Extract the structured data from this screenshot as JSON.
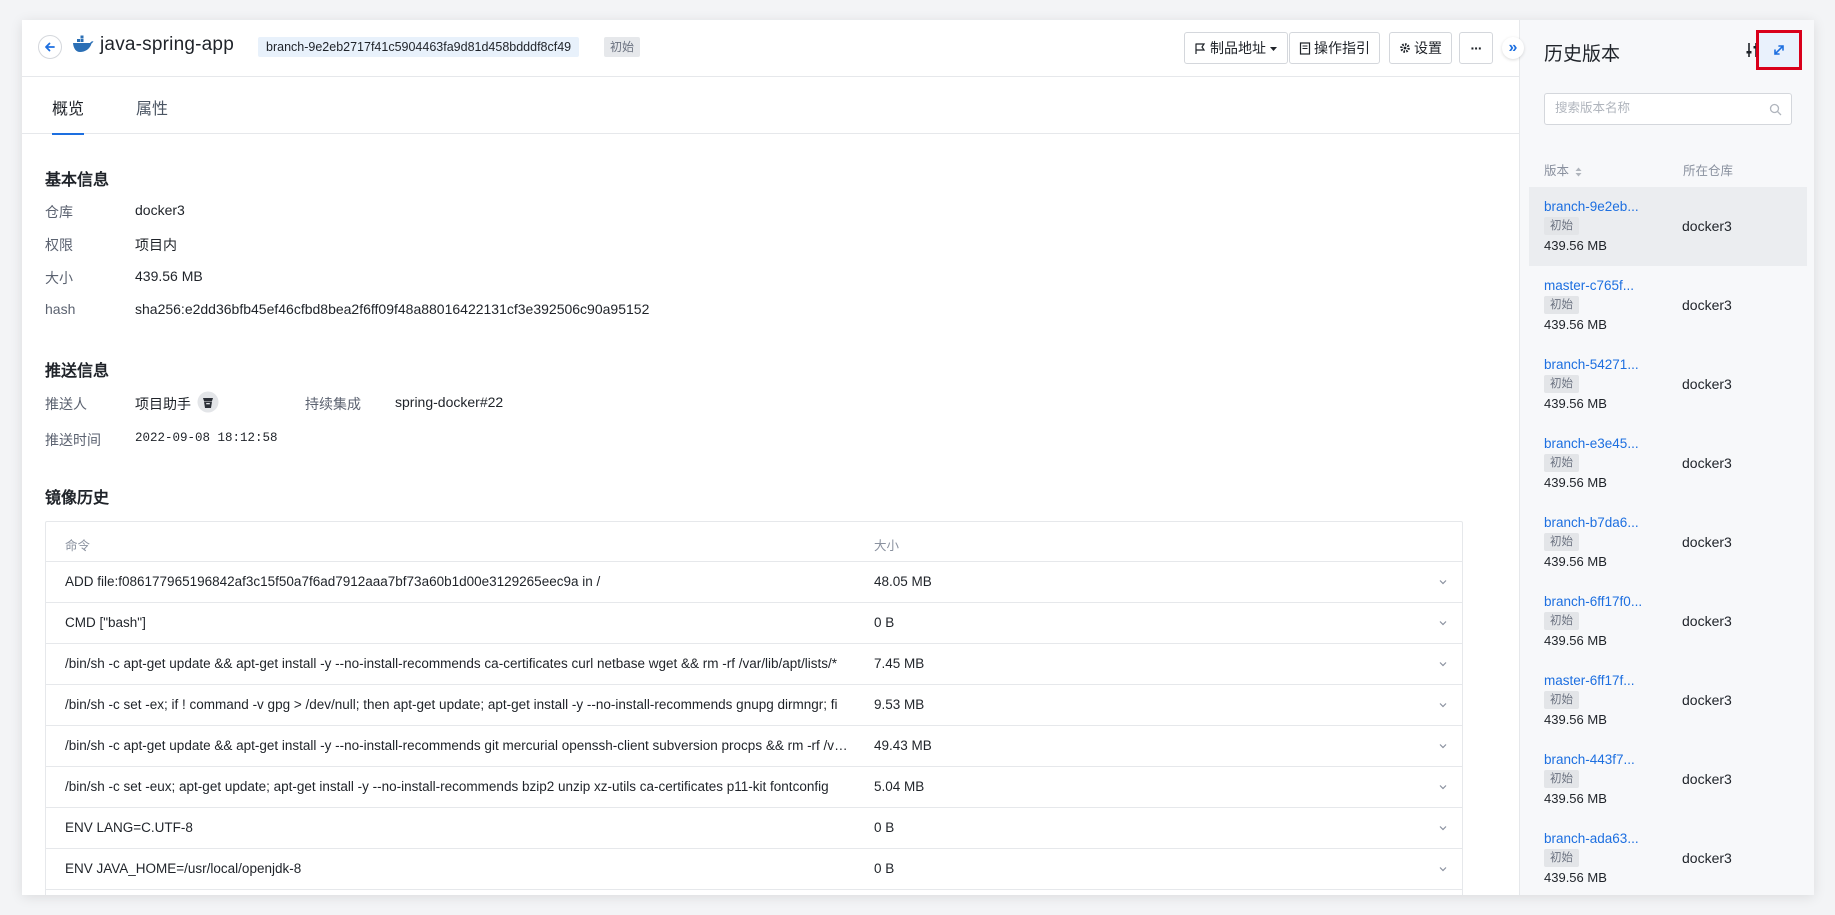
{
  "header": {
    "app_name": "java-spring-app",
    "branch": "branch-9e2eb2717f41c5904463fa9d81d458bdddf8cf49",
    "status_tag": "初始",
    "buttons": {
      "artifact_address": "制品地址",
      "guide": "操作指引",
      "settings": "设置",
      "more": "···"
    }
  },
  "tabs": [
    {
      "label": "概览"
    },
    {
      "label": "属性"
    }
  ],
  "basic_info": {
    "title": "基本信息",
    "rows": [
      {
        "label": "仓库",
        "value": "docker3"
      },
      {
        "label": "权限",
        "value": "项目内"
      },
      {
        "label": "大小",
        "value": "439.56 MB"
      },
      {
        "label": "hash",
        "value": "sha256:e2dd36bfb45ef46cfbd8bea2f6ff09f48a88016422131cf3e392506c90a95152"
      }
    ]
  },
  "push_info": {
    "title": "推送信息",
    "pusher_label": "推送人",
    "pusher_value": "项目助手",
    "ci_label": "持续集成",
    "ci_value": "spring-docker#22",
    "time_label": "推送时间",
    "time_value": "2022-09-08 18:12:58"
  },
  "image_history": {
    "title": "镜像历史",
    "columns": {
      "command": "命令",
      "size": "大小"
    },
    "rows": [
      {
        "command": "ADD file:f086177965196842af3c15f50a7f6ad7912aaa7bf73a60b1d00e3129265eec9a in /",
        "size": "48.05 MB"
      },
      {
        "command": "CMD [\"bash\"]",
        "size": "0 B"
      },
      {
        "command": "/bin/sh -c apt-get update && apt-get install -y --no-install-recommends ca-certificates curl netbase wget && rm -rf /var/lib/apt/lists/*",
        "size": "7.45 MB"
      },
      {
        "command": "/bin/sh -c set -ex; if ! command -v gpg > /dev/null; then apt-get update; apt-get install -y --no-install-recommends gnupg dirmngr; fi",
        "size": "9.53 MB"
      },
      {
        "command": "/bin/sh -c apt-get update && apt-get install -y --no-install-recommends git mercurial openssh-client subversion procps && rm -rf /var/lib/apt/lists/*",
        "size": "49.43 MB"
      },
      {
        "command": "/bin/sh -c set -eux; apt-get update; apt-get install -y --no-install-recommends bzip2 unzip xz-utils ca-certificates p11-kit fontconfig",
        "size": "5.04 MB"
      },
      {
        "command": "ENV LANG=C.UTF-8",
        "size": "0 B"
      },
      {
        "command": "ENV JAVA_HOME=/usr/local/openjdk-8",
        "size": "0 B"
      }
    ]
  },
  "history_panel": {
    "title": "历史版本",
    "search_placeholder": "搜索版本名称",
    "col_version": "版本",
    "col_repo": "所在仓库",
    "versions": [
      {
        "name": "branch-9e2eb...",
        "tag": "初始",
        "size": "439.56 MB",
        "repo": "docker3"
      },
      {
        "name": "master-c765f...",
        "tag": "初始",
        "size": "439.56 MB",
        "repo": "docker3"
      },
      {
        "name": "branch-54271...",
        "tag": "初始",
        "size": "439.56 MB",
        "repo": "docker3"
      },
      {
        "name": "branch-e3e45...",
        "tag": "初始",
        "size": "439.56 MB",
        "repo": "docker3"
      },
      {
        "name": "branch-b7da6...",
        "tag": "初始",
        "size": "439.56 MB",
        "repo": "docker3"
      },
      {
        "name": "branch-6ff17f0...",
        "tag": "初始",
        "size": "439.56 MB",
        "repo": "docker3"
      },
      {
        "name": "master-6ff17f...",
        "tag": "初始",
        "size": "439.56 MB",
        "repo": "docker3"
      },
      {
        "name": "branch-443f7...",
        "tag": "初始",
        "size": "439.56 MB",
        "repo": "docker3"
      },
      {
        "name": "branch-ada63...",
        "tag": "初始",
        "size": "439.56 MB",
        "repo": "docker3"
      }
    ]
  },
  "colors": {
    "accent": "#1d6fe0",
    "highlight_border": "#d9001b"
  }
}
